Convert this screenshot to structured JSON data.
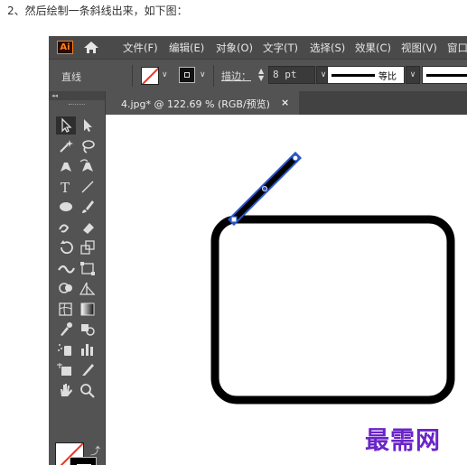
{
  "caption": "2、然后绘制一条斜线出来，如下图：",
  "app": {
    "logo": "Ai",
    "menu": [
      "文件(F)",
      "编辑(E)",
      "对象(O)",
      "文字(T)",
      "选择(S)",
      "效果(C)",
      "视图(V)",
      "窗口"
    ]
  },
  "control_bar": {
    "tool_name": "直线",
    "stroke_label": "描边：",
    "stroke_weight": "8 pt",
    "profile_label": "等比"
  },
  "document": {
    "tab_title": "4.jpg* @ 122.69 % (RGB/预览)",
    "close_glyph": "×"
  },
  "toolbar": {
    "collapse_glyph": "◂◂",
    "tools": [
      "selection-icon",
      "direct-selection-icon",
      "magic-wand-icon",
      "lasso-icon",
      "pen-icon",
      "curvature-icon",
      "type-icon",
      "line-segment-icon",
      "ellipse-icon",
      "paintbrush-icon",
      "shaper-icon",
      "eraser-icon",
      "rotate-icon",
      "scale-icon",
      "width-icon",
      "free-transform-icon",
      "shape-builder-icon",
      "perspective-grid-icon",
      "mesh-icon",
      "gradient-icon",
      "eyedropper-icon",
      "blend-icon",
      "symbol-sprayer-icon",
      "column-graph-icon",
      "artboard-icon",
      "slice-icon",
      "hand-icon",
      "zoom-icon"
    ]
  },
  "watermark": "最需网",
  "colors": {
    "accent": "#ff7f18",
    "selection_blue": "#2a56c6",
    "watermark": "#6a24c9"
  }
}
